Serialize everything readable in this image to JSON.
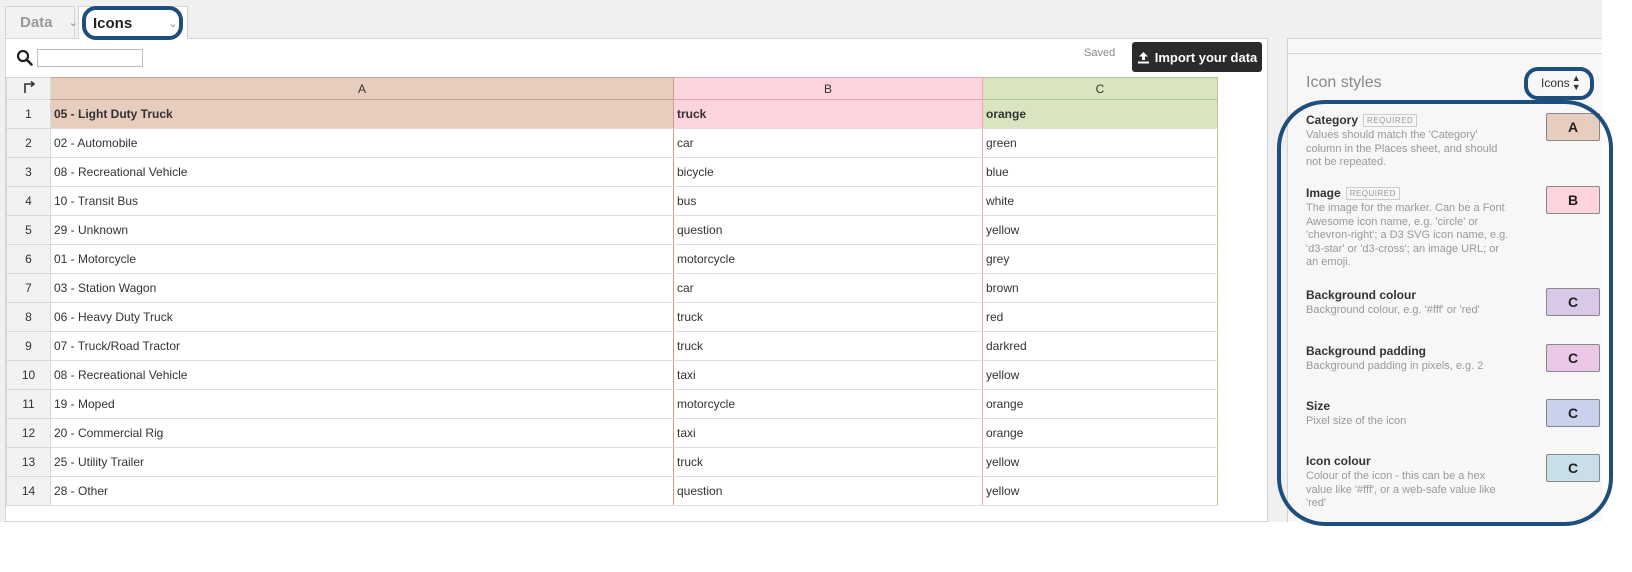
{
  "tabs": [
    {
      "label": "Data",
      "active": false
    },
    {
      "label": "Icons",
      "active": true
    }
  ],
  "toolbar": {
    "search_placeholder": "",
    "saved_label": "Saved",
    "import_label": "Import your data"
  },
  "grid": {
    "columns": [
      "A",
      "B",
      "C"
    ],
    "column_colors": [
      "#e6cdbe",
      "#fdd3dd",
      "#d9e5c1"
    ],
    "rows": [
      {
        "num": "1",
        "cells": [
          "05 - Light Duty Truck",
          "truck",
          "orange"
        ]
      },
      {
        "num": "2",
        "cells": [
          "02 - Automobile",
          "car",
          "green"
        ]
      },
      {
        "num": "3",
        "cells": [
          "08 - Recreational Vehicle",
          "bicycle",
          "blue"
        ]
      },
      {
        "num": "4",
        "cells": [
          "10 - Transit Bus",
          "bus",
          "white"
        ]
      },
      {
        "num": "5",
        "cells": [
          "29 - Unknown",
          "question",
          "yellow"
        ]
      },
      {
        "num": "6",
        "cells": [
          "01 - Motorcycle",
          "motorcycle",
          "grey"
        ]
      },
      {
        "num": "7",
        "cells": [
          "03 - Station Wagon",
          "car",
          "brown"
        ]
      },
      {
        "num": "8",
        "cells": [
          "06 - Heavy Duty Truck",
          "truck",
          "red"
        ]
      },
      {
        "num": "9",
        "cells": [
          "07 - Truck/Road Tractor",
          "truck",
          "darkred"
        ]
      },
      {
        "num": "10",
        "cells": [
          "08 - Recreational Vehicle",
          "taxi",
          "yellow"
        ]
      },
      {
        "num": "11",
        "cells": [
          "19 - Moped",
          "motorcycle",
          "orange"
        ]
      },
      {
        "num": "12",
        "cells": [
          "20 - Commercial Rig",
          "taxi",
          "orange"
        ]
      },
      {
        "num": "13",
        "cells": [
          "25 - Utility Trailer",
          "truck",
          "yellow"
        ]
      },
      {
        "num": "14",
        "cells": [
          "28 - Other",
          "question",
          "yellow"
        ]
      }
    ]
  },
  "panel": {
    "title": "Icon styles",
    "select_value": "Icons",
    "settings": [
      {
        "name": "Category",
        "required": "REQUIRED",
        "desc": "Values should match the 'Category' column in the Places sheet, and should not be repeated.",
        "column": "A",
        "color": "#e6cdbe"
      },
      {
        "name": "Image",
        "required": "REQUIRED",
        "desc": "The image for the marker. Can be a Font Awesome icon name, e.g. 'circle' or 'chevron-right'; a D3 SVG icon name, e.g. 'd3-star' or 'd3-cross'; an image URL; or an emoji.",
        "column": "B",
        "color": "#fdd3dd"
      },
      {
        "name": "Background colour",
        "required": "",
        "desc": "Background colour, e.g. '#fff' or 'red'",
        "column": "C",
        "color": "#d9c8e8"
      },
      {
        "name": "Background padding",
        "required": "",
        "desc": "Background padding in pixels, e.g. 2",
        "column": "C",
        "color": "#ebc7e6"
      },
      {
        "name": "Size",
        "required": "",
        "desc": "Pixel size of the icon",
        "column": "C",
        "color": "#c9d1ec"
      },
      {
        "name": "Icon colour",
        "required": "",
        "desc": "Colour of the icon - this can be a hex value like '#fff', or a web-safe value like 'red'",
        "column": "C",
        "color": "#c9dfe8"
      }
    ]
  },
  "accent_color": "#1d4e7e"
}
